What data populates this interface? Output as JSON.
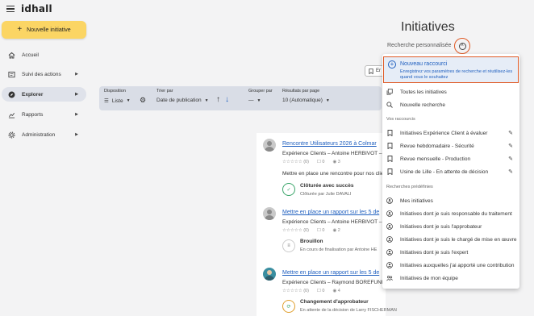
{
  "app": {
    "logo": "idhall"
  },
  "sidebar": {
    "new_button": "Nouvelle initiative",
    "items": [
      {
        "label": "Accueil",
        "icon": "home-icon"
      },
      {
        "label": "Suivi des actions",
        "icon": "tasks-icon"
      },
      {
        "label": "Explorer",
        "icon": "compass-icon"
      },
      {
        "label": "Rapports",
        "icon": "chart-icon"
      },
      {
        "label": "Administration",
        "icon": "gear-icon"
      }
    ]
  },
  "header": {
    "title": "Initiatives",
    "personalized_search": "Recherche personnalisée",
    "ghost_button": "Er"
  },
  "filters": {
    "disposition": {
      "label": "Disposition",
      "value": "Liste"
    },
    "sort": {
      "label": "Trier par",
      "value": "Date de publication"
    },
    "group": {
      "label": "Grouper par",
      "value": "—"
    },
    "per_page": {
      "label": "Résultats par page",
      "value": "10 (Automatique)"
    }
  },
  "cards": [
    {
      "title": "Rencontre Utilisateurs 2026 à Colmar",
      "subtitle": "Expérience Clients – Antoine HERBIVOT – 2",
      "rating": "(0)",
      "comments": "0",
      "views": "3",
      "description": "Mettre en place une rencontre pour nos clie",
      "status": "Clôturée avec succès",
      "status_sub": "Clôturée par Julie DAVALI"
    },
    {
      "title": "Mettre en place un rapport sur les 5 de",
      "subtitle": "Expérience Clients – Antoine HERBIVOT – 1",
      "rating": "(0)",
      "comments": "0",
      "views": "2",
      "status": "Brouillon",
      "status_sub": "En cours de finalisation par Antoine HE"
    },
    {
      "title": "Mettre en place un rapport sur les 5 de",
      "subtitle": "Expérience Clients – Raymond BOREFUNHS",
      "rating": "(0)",
      "comments": "0",
      "views": "4",
      "status": "Changement d'approbateur",
      "status_sub": "En attente de la décision de Larry FISCHERMAN"
    }
  ],
  "dropdown": {
    "new_shortcut": {
      "title": "Nouveau raccourci",
      "subtitle": "Enregistrez vos paramètres de recherche et réutilisez-les quand vous le souhaitez"
    },
    "all_initiatives": "Toutes les initiatives",
    "new_search": "Nouvelle recherche",
    "shortcuts_header": "Vos raccourcis",
    "shortcuts": [
      "Initiatives Expérience Client à évaluer",
      "Revue hebdomadaire - Sécurité",
      "Revue mensuelle - Production",
      "Usine de Lille - En attente de décision"
    ],
    "predefined_header": "Recherches prédéfinies",
    "predefined": [
      "Mes initiatives",
      "Initiatives dont je suis responsable du traitement",
      "Initiatives dont je suis l'approbateur",
      "Initiatives dont je suis le chargé de mise en œuvre",
      "Initiatives dont je suis l'expert",
      "Initiatives auxquelles j'ai apporté une contribution",
      "Initiatives de mon équipe"
    ]
  }
}
